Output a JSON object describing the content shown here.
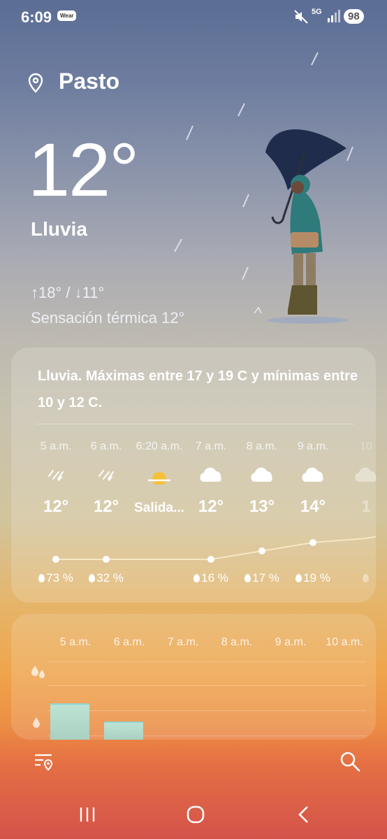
{
  "status_bar": {
    "time": "6:09",
    "wear_badge": "Wear",
    "network": "5G",
    "battery": "98",
    "icons": [
      "mute-icon",
      "signal-icon"
    ]
  },
  "location": {
    "name": "Pasto",
    "icon": "location-pin-icon"
  },
  "current": {
    "temperature": "12°",
    "condition": "Lluvia",
    "minmax": "↑18° / ↓11°",
    "feels_like": "Sensación térmica 12°"
  },
  "forecast": {
    "summary": "Lluvia. Máximas entre 17 y 19 C y mínimas entre 10 y 12 C.",
    "hours": [
      {
        "time": "5 a.m.",
        "icon": "rain-icon",
        "temp": "12°",
        "precip": "73 %",
        "temp_value": 12
      },
      {
        "time": "6 a.m.",
        "icon": "rain-icon",
        "temp": "12°",
        "precip": "32 %",
        "temp_value": 12
      },
      {
        "time": "6:20 a.m.",
        "icon": "sunrise-icon",
        "temp": "Salida...",
        "precip": "",
        "temp_value": null
      },
      {
        "time": "7 a.m.",
        "icon": "cloud-icon",
        "temp": "12°",
        "precip": "16 %",
        "temp_value": 12
      },
      {
        "time": "8 a.m.",
        "icon": "cloud-icon",
        "temp": "13°",
        "precip": "17 %",
        "temp_value": 13
      },
      {
        "time": "9 a.m.",
        "icon": "cloud-icon",
        "temp": "14°",
        "precip": "19 %",
        "temp_value": 14
      },
      {
        "time": "10",
        "icon": "cloud-icon",
        "temp": "1",
        "precip": "",
        "temp_value": 14.5
      }
    ]
  },
  "precipitation": {
    "times": [
      "5 a.m.",
      "6 a.m.",
      "7 a.m.",
      "8 a.m.",
      "9 a.m.",
      "10 a.m."
    ],
    "amounts": [
      0.5,
      0.25,
      0,
      0,
      0,
      0
    ],
    "icons": [
      "heavy-rain-drops-icon",
      "light-rain-drop-icon"
    ]
  },
  "bottom_bar": {
    "icons": [
      "location-list-icon",
      "search-icon"
    ]
  },
  "nav_bar": {
    "icons": [
      "recent-apps-icon",
      "home-icon",
      "back-icon"
    ]
  },
  "colors": {
    "accent_line": "#f6e8c4",
    "sun": "#f6c03a",
    "precip_bar": "#bde3d4"
  }
}
